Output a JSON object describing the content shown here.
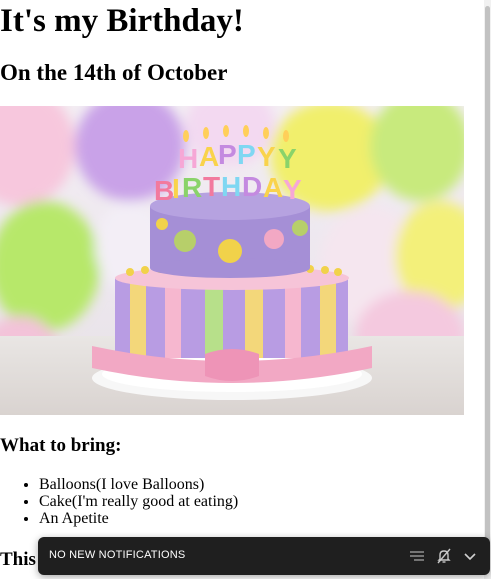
{
  "page": {
    "heading": "It's my Birthday!",
    "subheading": "On the 14th of October",
    "hero_image": {
      "cake_topper_text": "HAPPY BIRTHDAY",
      "colors": {
        "cake_top": "#a58fd6",
        "cake_bottom_stripe_a": "#b89ce3",
        "cake_bottom_stripe_b": "#f3d77a",
        "ribbon": "#f2a8c4",
        "balloon_yellow": "#f1ef6c",
        "balloon_green": "#b7e86b",
        "balloon_purple": "#c9a2e8"
      }
    },
    "bring_heading": "What to bring:",
    "bring_items": [
      "Balloons(I love Balloons)",
      "Cake(I'm really good at eating)",
      "An Apetite"
    ],
    "partial_heading": "This"
  },
  "toast": {
    "text": "NO NEW NOTIFICATIONS",
    "buttons": [
      "clear-all-icon",
      "do-not-disturb-icon",
      "chevron-down-icon"
    ]
  }
}
